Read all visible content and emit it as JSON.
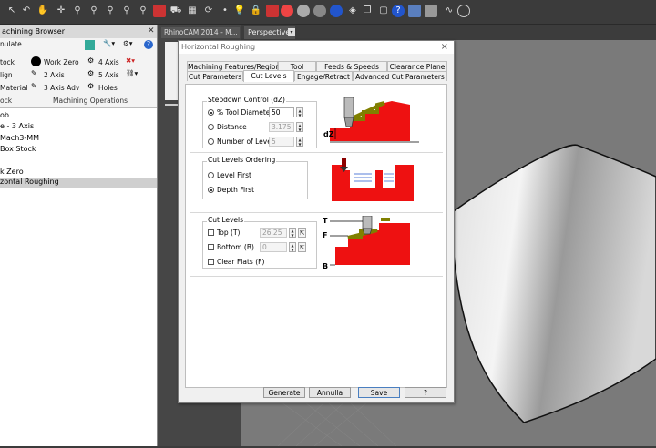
{
  "colors": {
    "accent": "#0078d7",
    "red_fill": "#ee1111",
    "olive": "#808000"
  },
  "browser": {
    "title": "achining Browser",
    "simulate_label": "nulate",
    "ribbon": {
      "stock": "tock",
      "align": "lign",
      "material": "Material",
      "work_zero": "Work Zero",
      "two_axis": "2 Axis",
      "three_axis_adv": "3 Axis Adv",
      "four_axis": "4 Axis",
      "five_axis": "5 Axis",
      "holes": "Holes",
      "group_left": "ock",
      "group_right": "Machining Operations"
    },
    "tree": [
      "ob",
      "e - 3 Axis",
      "Mach3-MM",
      "Box Stock",
      "k Zero",
      "zontal Roughing"
    ]
  },
  "mid": {
    "tab": "RhinoCAM 2014 - M..."
  },
  "viewport": {
    "tab": "Perspective"
  },
  "dialog": {
    "title": "Horizontal Roughing",
    "close": "×",
    "tabs_row1": [
      "Machining Features/Regions",
      "Tool",
      "Feeds & Speeds",
      "Clearance Plane"
    ],
    "tabs_row2": [
      "Cut Parameters",
      "Cut Levels",
      "Engage/Retract",
      "Advanced Cut Parameters"
    ],
    "stepdown": {
      "title": "Stepdown Control (dZ)",
      "opt1": "% Tool Diameter",
      "opt1_value": "50",
      "opt2": "Distance",
      "opt2_value": "3.175",
      "opt3": "Number of Levels",
      "opt3_value": "5",
      "diagram_label": "dZ"
    },
    "ordering": {
      "title": "Cut Levels Ordering",
      "opt1": "Level First",
      "opt2": "Depth First"
    },
    "cutlevels": {
      "title": "Cut Levels",
      "top": "Top (T)",
      "top_value": "26.25",
      "bottom": "Bottom (B)",
      "bottom_value": "0",
      "clear": "Clear Flats (F)",
      "diagram_t": "T",
      "diagram_f": "F",
      "diagram_b": "B"
    },
    "buttons": {
      "generate": "Generate",
      "cancel": "Annulla",
      "save": "Save",
      "help": "?"
    }
  }
}
